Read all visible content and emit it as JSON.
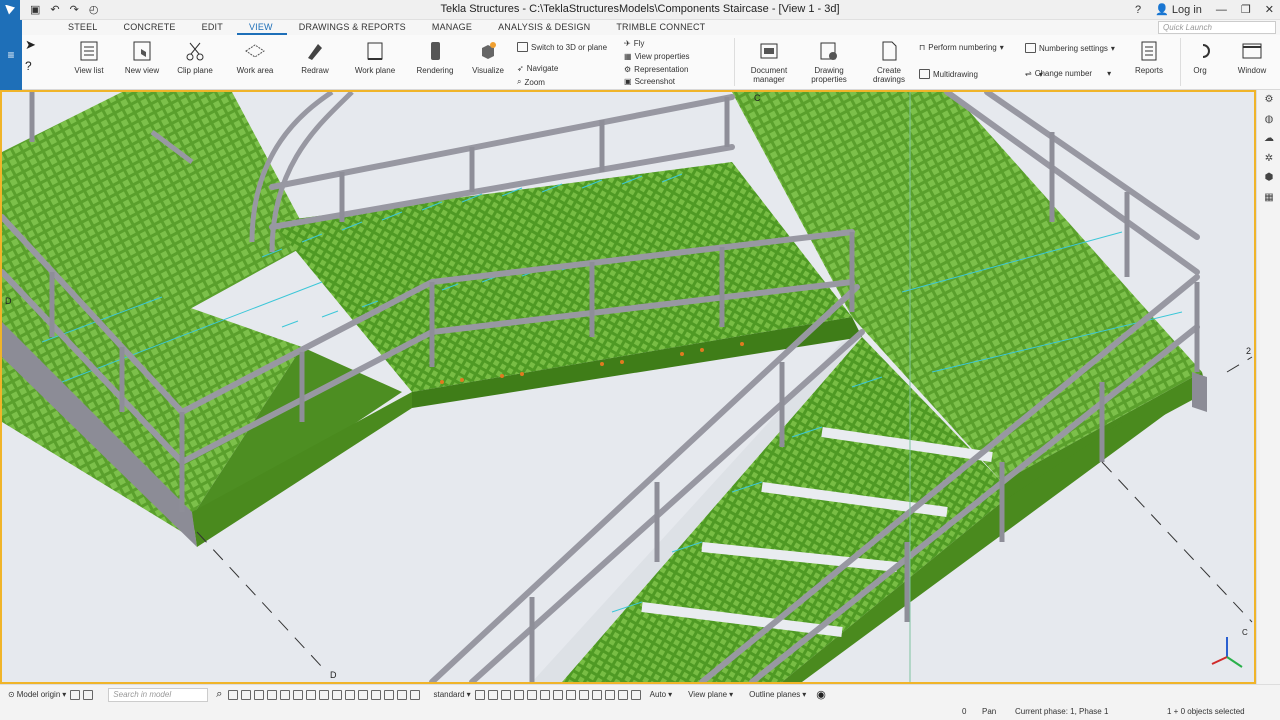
{
  "window": {
    "title": "Tekla Structures - C:\\TeklaStructuresModels\\Components Staircase - [View 1 - 3d]",
    "login": "Log in"
  },
  "menu": {
    "tabs": [
      "STEEL",
      "CONCRETE",
      "EDIT",
      "VIEW",
      "DRAWINGS & REPORTS",
      "MANAGE",
      "ANALYSIS & DESIGN",
      "TRIMBLE CONNECT"
    ],
    "active": "VIEW",
    "quick_launch_placeholder": "Quick Launch"
  },
  "ribbon": {
    "view_list": "View list",
    "new_view": "New view",
    "clip_plane": "Clip plane",
    "work_area": "Work area",
    "redraw": "Redraw",
    "work_plane": "Work plane",
    "rendering": "Rendering",
    "visualize": "Visualize",
    "switch_3d": "Switch to 3D or plane",
    "navigate": "Navigate",
    "zoom": "Zoom",
    "fly": "Fly",
    "view_properties": "View properties",
    "representation": "Representation",
    "screenshot": "Screenshot",
    "document_manager_1": "Document",
    "document_manager_2": "manager",
    "drawing_properties_1": "Drawing",
    "drawing_properties_2": "properties",
    "create_drawings_1": "Create",
    "create_drawings_2": "drawings",
    "perform_numbering": "Perform numbering",
    "multidrawing": "Multidrawing",
    "numbering_settings": "Numbering settings",
    "change_number": "Change number",
    "reports": "Reports",
    "org": "Org",
    "window": "Window"
  },
  "viewport": {
    "grid_labels": {
      "c_top": "C",
      "d_left": "D",
      "two_right": "2",
      "d_bottom": "D"
    },
    "colors": {
      "frame": "#f0b429",
      "grating": "#5aa02c",
      "steel": "#9c9ca6",
      "handrail": "#8f8f99"
    },
    "axis": {
      "c": "C"
    }
  },
  "bottom_toolbar": {
    "model_origin": "Model origin",
    "search_placeholder": "Search in model",
    "standard": "standard",
    "auto": "Auto",
    "view_plane": "View plane",
    "outline_planes": "Outline planes"
  },
  "status": {
    "coord": "0",
    "mode": "Pan",
    "phase": "Current phase: 1, Phase 1",
    "selected": "1 + 0 objects selected"
  }
}
